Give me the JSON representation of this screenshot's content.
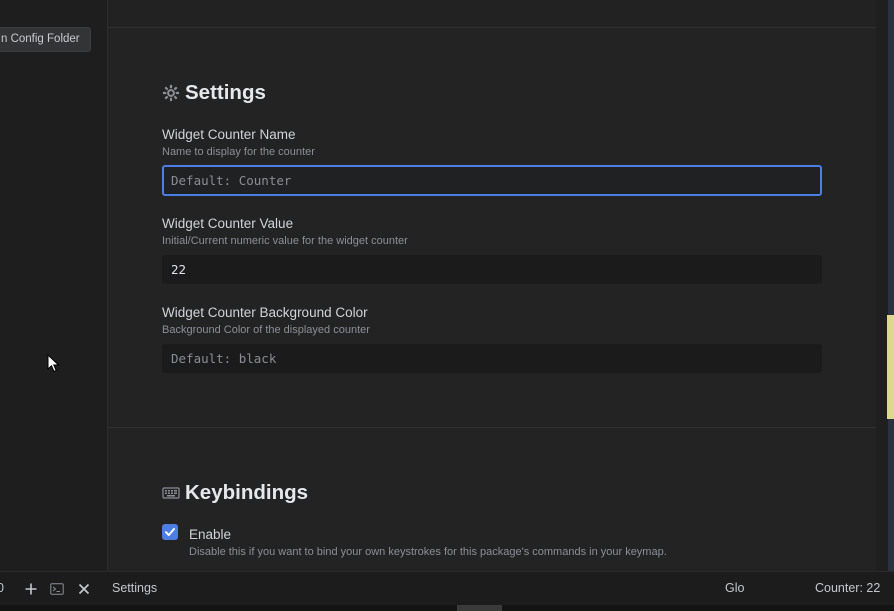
{
  "sidebar": {
    "config_button_label": "n Config Folder"
  },
  "settings_section": {
    "title": "Settings",
    "icon": "gear-icon",
    "fields": [
      {
        "label": "Widget Counter Name",
        "description": "Name to display for the counter",
        "value": "",
        "placeholder": "Default: Counter"
      },
      {
        "label": "Widget Counter Value",
        "description": "Initial/Current numeric value for the widget counter",
        "value": "22",
        "placeholder": ""
      },
      {
        "label": "Widget Counter Background Color",
        "description": "Background Color of the displayed counter",
        "value": "",
        "placeholder": "Default: black"
      }
    ]
  },
  "keybindings_section": {
    "title": "Keybindings",
    "icon": "keyboard-icon",
    "enable": {
      "label": "Enable",
      "checked": true,
      "description": "Disable this if you want to bind your own keystrokes for this package's commands in your keymap."
    }
  },
  "statusbar": {
    "left_partial": "0",
    "tab_label": "Settings",
    "glo_label": "Glo",
    "counter_label": "Counter: 22"
  },
  "colors": {
    "accent": "#4d7ee3",
    "background": "#232324",
    "edge_highlight": "#ded88e"
  }
}
